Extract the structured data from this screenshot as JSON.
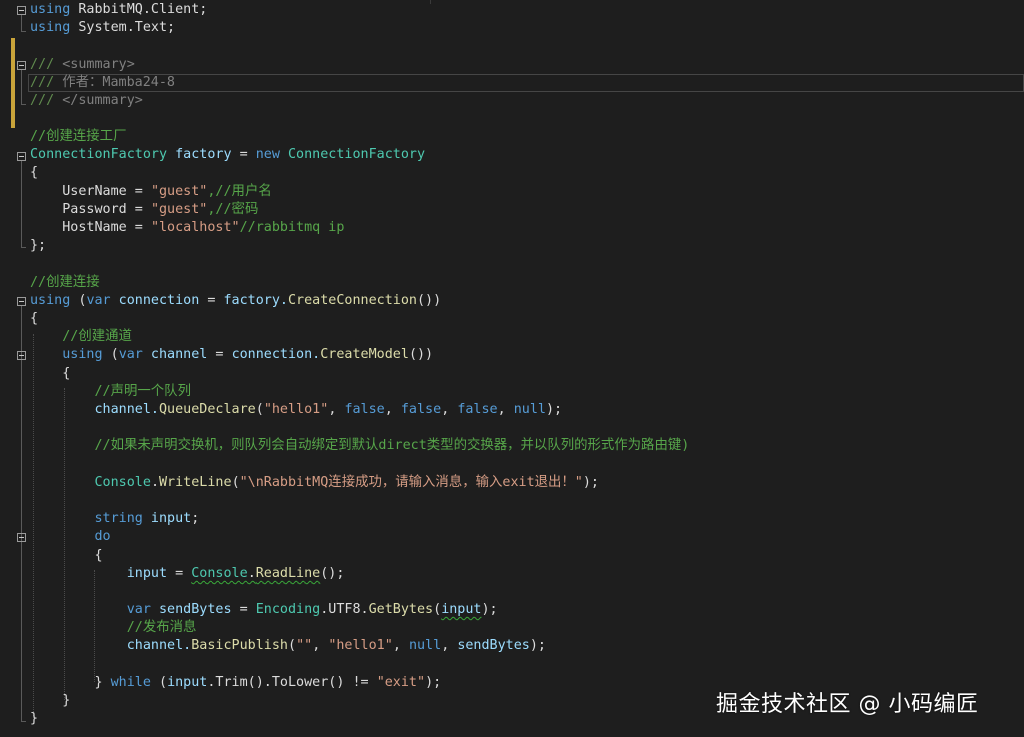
{
  "code": {
    "l1": {
      "kw": "using",
      "rest": " RabbitMQ.Client;"
    },
    "l2": {
      "kw": "using",
      "rest": " System.Text;"
    },
    "l4": {
      "a": "///",
      "b": " <summary>"
    },
    "l5": {
      "a": "///",
      "b": " 作者：Mamba24-8"
    },
    "l6": {
      "a": "///",
      "b": " </summary>"
    },
    "l8": "//创建连接工厂",
    "l9": {
      "type": "ConnectionFactory",
      "var": " factory",
      "op": " = ",
      "kw": "new",
      "type2": " ConnectionFactory"
    },
    "l10": "{",
    "l11": {
      "prop": "    UserName = ",
      "str": "\"guest\"",
      "cm": ",//用户名"
    },
    "l12": {
      "prop": "    Password = ",
      "str": "\"guest\"",
      "cm": ",//密码"
    },
    "l13": {
      "prop": "    HostName = ",
      "str": "\"localhost\"",
      "cm": "//rabbitmq ip"
    },
    "l14": "};",
    "l16": "//创建连接",
    "l17": {
      "kw": "using",
      "p1": " (",
      "kw2": "var",
      "var": " connection",
      "op": " = ",
      "obj": "factory.",
      "fn": "CreateConnection",
      "end": "())"
    },
    "l18": "{",
    "l19": "    //创建通道",
    "l20": {
      "ind": "    ",
      "kw": "using",
      "p1": " (",
      "kw2": "var",
      "var": " channel",
      "op": " = ",
      "obj": "connection.",
      "fn": "CreateModel",
      "end": "())"
    },
    "l21": "    {",
    "l22": "        //声明一个队列",
    "l23": {
      "ind": "        ",
      "obj": "channel.",
      "fn": "QueueDeclare",
      "p1": "(",
      "str": "\"hello1\"",
      "c1": ", ",
      "b1": "false",
      "c2": ", ",
      "b2": "false",
      "c3": ", ",
      "b3": "false",
      "c4": ", ",
      "n": "null",
      "end": ");"
    },
    "l25": "        //如果未声明交换机，则队列会自动绑定到默认direct类型的交换器，并以队列的形式作为路由键)",
    "l27": {
      "ind": "        ",
      "type": "Console",
      "dot": ".",
      "fn": "WriteLine",
      "p1": "(",
      "str": "\"\\nRabbitMQ连接成功，请输入消息，输入exit退出！\"",
      "end": ");"
    },
    "l29": {
      "ind": "        ",
      "kw": "string",
      "var": " input",
      "end": ";"
    },
    "l30": {
      "ind": "        ",
      "kw": "do"
    },
    "l31": "        {",
    "l32": {
      "ind": "            ",
      "var": "input",
      "op": " = ",
      "type": "Console",
      "dot": ".",
      "fn": "ReadLine",
      "end": "();"
    },
    "l34": {
      "ind": "            ",
      "kw": "var",
      "var": " sendBytes",
      "op": " = ",
      "type": "Encoding",
      "mid": ".UTF8.",
      "fn": "GetBytes",
      "p1": "(",
      "arg": "input",
      "end": ");"
    },
    "l35": "            //发布消息",
    "l36": {
      "ind": "            ",
      "obj": "channel.",
      "fn": "BasicPublish",
      "p1": "(",
      "s1": "\"\"",
      "c1": ", ",
      "s2": "\"hello1\"",
      "c2": ", ",
      "n": "null",
      "c3": ", ",
      "arg": "sendBytes",
      "end": ");"
    },
    "l38": {
      "ind": "        } ",
      "kw": "while",
      "p1": " (",
      "v": "input",
      "mid": ".Trim().ToLower() != ",
      "str": "\"exit\"",
      "end": ");"
    },
    "l39": "    }",
    "l40": "}"
  },
  "watermark": "掘金技术社区 @ 小码编匠",
  "colors": {
    "background": "#1e1e1e",
    "keyword": "#569cd6",
    "type": "#4ec9b0",
    "comment": "#57a64a",
    "string": "#d69d85",
    "method": "#dcdcaa",
    "variable": "#9cdcfe",
    "change_marker": "#c9a43a"
  }
}
